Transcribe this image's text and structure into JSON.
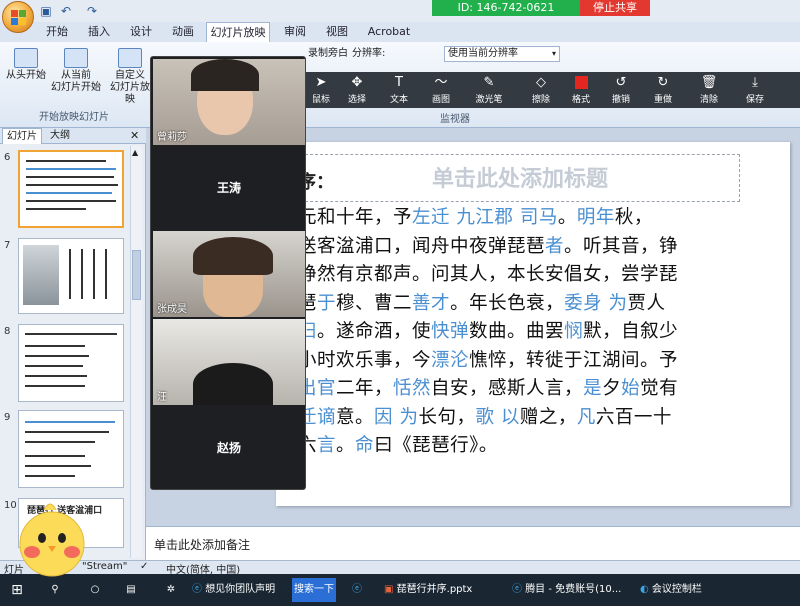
{
  "quick_access": {
    "undo_icon": "undo-icon",
    "redo_icon": "redo-icon",
    "save_icon": "save-icon"
  },
  "meeting": {
    "id_text": "ID: 146-742-0621",
    "stop_share": "停止共享"
  },
  "ribbon": {
    "tabs": [
      "开始",
      "插入",
      "设计",
      "动画",
      "幻灯片放映",
      "审阅",
      "视图",
      "Acrobat"
    ],
    "active_tab": "幻灯片放映",
    "items": {
      "from_start": "从头开始",
      "from_current_1": "从当前",
      "from_current_2": "幻灯片开始",
      "custom_1": "自定义",
      "custom_2": "幻灯片放映",
      "record_partial": "录制旁白",
      "resolution_label": "分辨率:",
      "resolution_value": "使用当前分辨率"
    },
    "group_label": "开始放映幻灯片",
    "monitor_label": "监视器"
  },
  "annotation_toolbar": [
    {
      "label": "鼠标",
      "icon": "pointer-icon"
    },
    {
      "label": "选择",
      "icon": "move-icon"
    },
    {
      "label": "文本",
      "icon": "text-icon"
    },
    {
      "label": "画图",
      "icon": "draw-icon"
    },
    {
      "label": "激光笔",
      "icon": "laser-pointer-icon"
    },
    {
      "label": "擦除",
      "icon": "eraser-icon"
    },
    {
      "label": "格式",
      "icon": "format-icon",
      "color": "#e5251f"
    },
    {
      "label": "撤销",
      "icon": "undo-icon"
    },
    {
      "label": "重做",
      "icon": "redo-icon"
    },
    {
      "label": "清除",
      "icon": "trash-icon"
    },
    {
      "label": "保存",
      "icon": "save-icon"
    }
  ],
  "slide_panel": {
    "tabs": [
      "幻灯片",
      "大纲"
    ],
    "close_icon": "close-icon",
    "slides": [
      {
        "num": "6",
        "selected": true
      },
      {
        "num": "7",
        "selected": false
      },
      {
        "num": "8",
        "selected": false
      },
      {
        "num": "9",
        "selected": false
      },
      {
        "num": "10",
        "selected": false,
        "title": "琵琶行 送客湓浦口"
      }
    ]
  },
  "video_panel": {
    "participants": [
      {
        "name": "曾莉莎",
        "kind": "video"
      },
      {
        "name": "王涛",
        "kind": "label"
      },
      {
        "name": "张成昊",
        "kind": "video"
      },
      {
        "name": "汪",
        "kind": "video"
      },
      {
        "name": "赵扬",
        "kind": "label"
      }
    ]
  },
  "slide": {
    "title_placeholder": "单击此处添加标题",
    "preface_heading": "序：",
    "body_lines": [
      [
        {
          "t": "元和十年，予"
        },
        {
          "t": "左迁",
          "h": true
        },
        {
          "t": "  "
        },
        {
          "t": "九江郡",
          "h": true
        },
        {
          "t": "  "
        },
        {
          "t": "司马",
          "h": true
        },
        {
          "t": "。"
        },
        {
          "t": "明年",
          "h": true
        },
        {
          "t": "秋，"
        }
      ],
      [
        {
          "t": "送客湓浦口，闻舟中夜弹琵琶"
        },
        {
          "t": "者",
          "h": true
        },
        {
          "t": "。听其音，铮"
        }
      ],
      [
        {
          "t": "铮然有京都声。问其人，本长安倡女，尝学琵"
        }
      ],
      [
        {
          "t": "琶"
        },
        {
          "t": "于",
          "h": true
        },
        {
          "t": "穆、曹二"
        },
        {
          "t": "善才",
          "h": true
        },
        {
          "t": "。年长色衰，"
        },
        {
          "t": "委身",
          "h": true
        },
        {
          "t": "  "
        },
        {
          "t": "为",
          "h": true
        },
        {
          "t": "贾人"
        }
      ],
      [
        {
          "t": "妇",
          "h": true
        },
        {
          "t": "。遂命酒，使"
        },
        {
          "t": "快弹",
          "h": true
        },
        {
          "t": "数曲。曲罢"
        },
        {
          "t": "悯",
          "h": true
        },
        {
          "t": "默，自叙少"
        }
      ],
      [
        {
          "t": "小时欢乐事，今"
        },
        {
          "t": "漂沦",
          "h": true
        },
        {
          "t": "憔悴，转徙于江湖间。予"
        }
      ],
      [
        {
          "t": "出官",
          "h": true
        },
        {
          "t": "二年，"
        },
        {
          "t": "恬然",
          "h": true
        },
        {
          "t": "自安，感斯人言，"
        },
        {
          "t": "是",
          "h": true
        },
        {
          "t": "夕"
        },
        {
          "t": "始",
          "h": true
        },
        {
          "t": "觉有"
        }
      ],
      [
        {
          "t": "迁谪",
          "h": true
        },
        {
          "t": "意。"
        },
        {
          "t": "因",
          "h": true
        },
        {
          "t": "  "
        },
        {
          "t": "为",
          "h": true
        },
        {
          "t": "长句，"
        },
        {
          "t": "歌",
          "h": true
        },
        {
          "t": " "
        },
        {
          "t": "以",
          "h": true
        },
        {
          "t": "赠之，"
        },
        {
          "t": "凡",
          "h": true
        },
        {
          "t": "六百一十"
        }
      ],
      [
        {
          "t": "六"
        },
        {
          "t": "言",
          "h": true
        },
        {
          "t": "。"
        },
        {
          "t": "命",
          "h": true
        },
        {
          "t": "曰《琵琶行》。"
        }
      ]
    ]
  },
  "notes": {
    "placeholder": "单击此处添加备注"
  },
  "status": {
    "left": "灯片",
    "theme": "\"Stream\"",
    "language": "中文(简体, 中国)"
  },
  "taskbar": {
    "items": [
      {
        "label": "想见你团队声明",
        "icon": "edge-icon"
      },
      {
        "label": "搜索一下",
        "icon": ""
      },
      {
        "label": "琵琶行并序.pptx",
        "icon": "powerpoint-icon"
      },
      {
        "label": "腾目 - 免费账号(10...",
        "icon": "edge-icon"
      },
      {
        "label": "会议控制栏",
        "icon": "meeting-icon"
      }
    ]
  },
  "colors": {
    "accent": "#4a8fd1",
    "meeting_green": "#22b04d",
    "stop_red": "#e2382f"
  }
}
